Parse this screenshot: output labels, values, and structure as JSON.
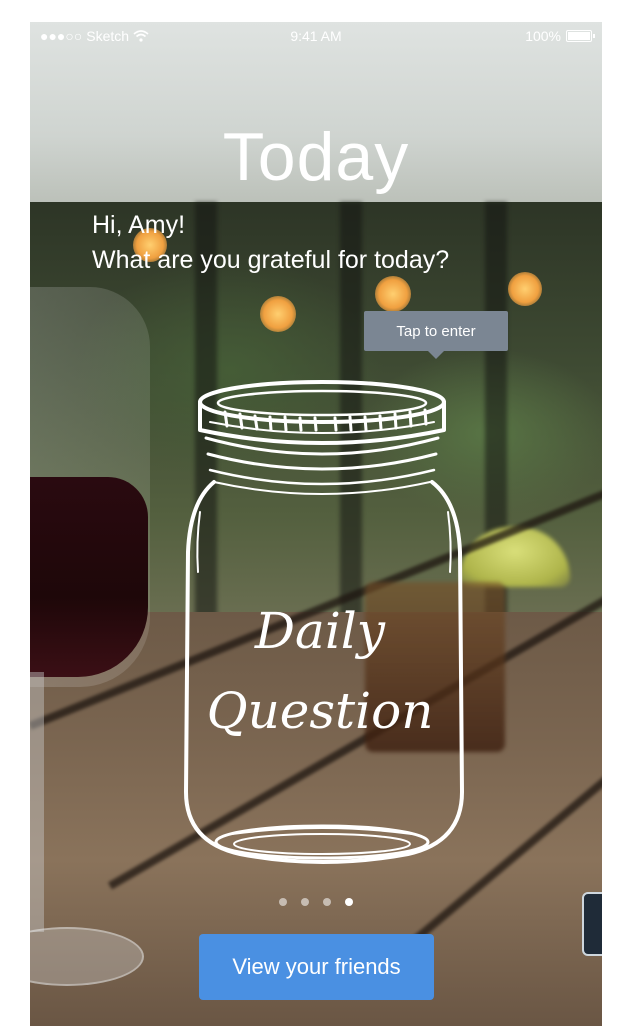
{
  "status_bar": {
    "carrier": "Sketch",
    "time": "9:41 AM",
    "battery": "100%"
  },
  "screen": {
    "title": "Today",
    "greeting_line1": "Hi, Amy!",
    "greeting_line2": "What are you grateful for today?"
  },
  "tooltip": {
    "label": "Tap to enter"
  },
  "jar": {
    "line1": "Daily",
    "line2": "Question"
  },
  "pager": {
    "count": 4,
    "active_index": 3
  },
  "cta": {
    "label": "View your friends",
    "color": "#4a90e2"
  },
  "icons": [
    "signal-dots-icon",
    "wifi-icon",
    "battery-icon",
    "mason-jar-illustration"
  ]
}
